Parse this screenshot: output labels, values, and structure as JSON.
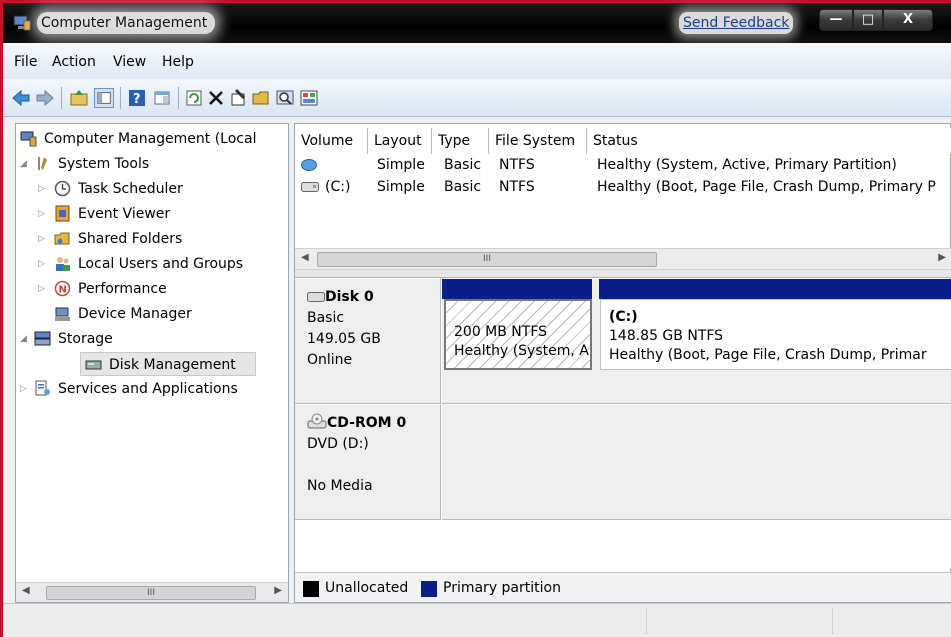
{
  "window": {
    "title": "Computer Management",
    "feedback_link": "Send Feedback",
    "buttons": {
      "minimize": "—",
      "maximize": "□",
      "close": "X"
    }
  },
  "menubar": {
    "items": [
      "File",
      "Action",
      "View",
      "Help"
    ]
  },
  "toolbar": {
    "icons": [
      "back-arrow-icon",
      "forward-arrow-icon",
      "up-folder-icon",
      "show-hide-tree-icon",
      "help-icon",
      "properties-pane-icon",
      "refresh-icon",
      "delete-icon",
      "properties-icon",
      "open-folder-icon",
      "search-icon",
      "console-icon"
    ],
    "delete_glyph": "X"
  },
  "tree": {
    "root": "Computer Management (Local",
    "items": [
      {
        "label": "System Tools",
        "expanded": true
      },
      {
        "label": "Task Scheduler"
      },
      {
        "label": "Event Viewer"
      },
      {
        "label": "Shared Folders"
      },
      {
        "label": "Local Users and Groups"
      },
      {
        "label": "Performance"
      },
      {
        "label": "Device Manager"
      },
      {
        "label": "Storage",
        "expanded": true
      },
      {
        "label": "Disk Management",
        "selected": true
      },
      {
        "label": "Services and Applications"
      }
    ],
    "scroll_glyph": "III"
  },
  "volumes": {
    "columns": [
      "Volume",
      "Layout",
      "Type",
      "File System",
      "Status"
    ],
    "rows": [
      {
        "volume": "",
        "layout": "Simple",
        "type": "Basic",
        "fs": "NTFS",
        "status": "Healthy (System, Active, Primary Partition)"
      },
      {
        "volume": "(C:)",
        "layout": "Simple",
        "type": "Basic",
        "fs": "NTFS",
        "status": "Healthy (Boot, Page File, Crash Dump, Primary P"
      }
    ],
    "scroll_glyph": "III"
  },
  "disks": [
    {
      "name": "Disk 0",
      "type": "Basic",
      "size": "149.05 GB",
      "state": "Online",
      "partitions": [
        {
          "title": "",
          "size": "200 MB NTFS",
          "status": "Healthy (System, A"
        },
        {
          "title": "(C:)",
          "size": "148.85 GB NTFS",
          "status": "Healthy (Boot, Page File, Crash Dump, Primar"
        }
      ]
    },
    {
      "name": "CD-ROM 0",
      "type": "DVD (D:)",
      "media": "No Media"
    }
  ],
  "legend": {
    "items": [
      {
        "label": "Unallocated",
        "color": "#000000"
      },
      {
        "label": "Primary partition",
        "color": "#0b1f8a"
      }
    ]
  },
  "colors": {
    "accent_border": "#c8102e",
    "partition_bar": "#0b1f8a"
  }
}
